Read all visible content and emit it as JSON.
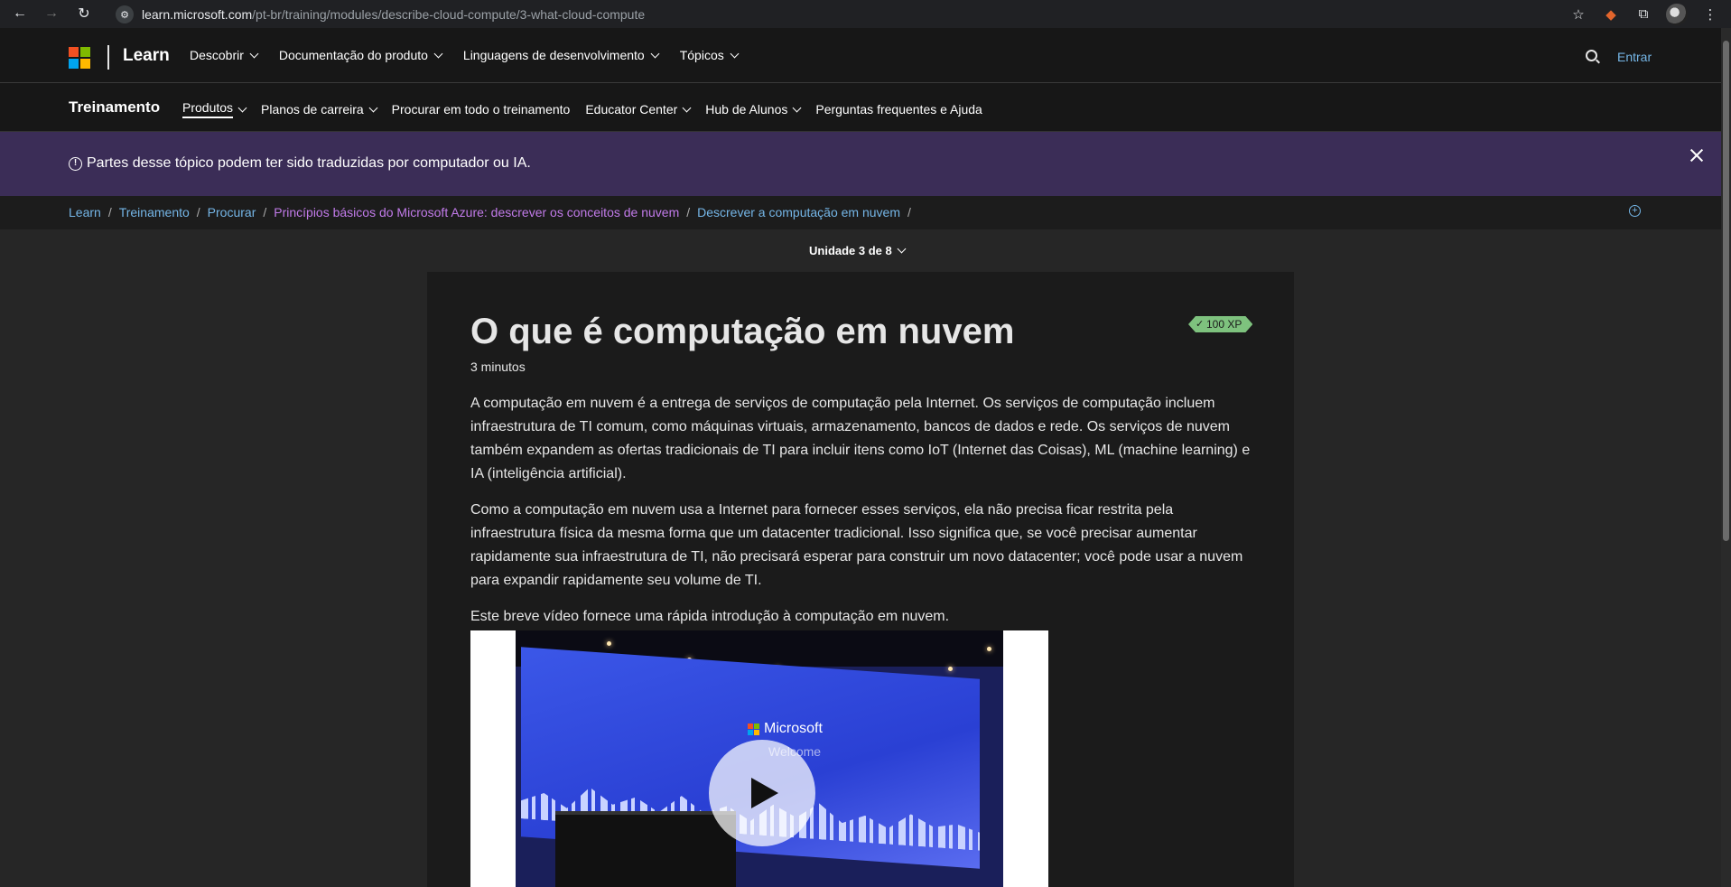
{
  "browser": {
    "url_host": "learn.microsoft.com",
    "url_path": "/pt-br/training/modules/describe-cloud-compute/3-what-cloud-compute"
  },
  "header": {
    "brand": "Learn",
    "nav": [
      "Descobrir",
      "Documentação do produto",
      "Linguagens de desenvolvimento",
      "Tópicos"
    ],
    "signin": "Entrar"
  },
  "subheader": {
    "brand": "Treinamento",
    "nav": [
      "Produtos",
      "Planos de carreira",
      "Procurar em todo o treinamento",
      "Educator Center",
      "Hub de Alunos",
      "Perguntas frequentes e Ajuda"
    ]
  },
  "banner": {
    "text": "Partes desse tópico podem ter sido traduzidas por computador ou IA."
  },
  "breadcrumb": [
    "Learn",
    "Treinamento",
    "Procurar",
    "Princípios básicos do Microsoft Azure: descrever os conceitos de nuvem",
    "Descrever a computação em nuvem"
  ],
  "unit_selector": "Unidade 3 de 8",
  "article": {
    "title": "O que é computação em nuvem",
    "duration": "3 minutos",
    "xp": "100 XP",
    "paragraphs": [
      "A computação em nuvem é a entrega de serviços de computação pela Internet. Os serviços de computação incluem infraestrutura de TI comum, como máquinas virtuais, armazenamento, bancos de dados e rede. Os serviços de nuvem também expandem as ofertas tradicionais de TI para incluir itens como IoT (Internet das Coisas), ML (machine learning) e IA (inteligência artificial).",
      "Como a computação em nuvem usa a Internet para fornecer esses serviços, ela não precisa ficar restrita pela infraestrutura física da mesma forma que um datacenter tradicional. Isso significa que, se você precisar aumentar rapidamente sua infraestrutura de TI, não precisará esperar para construir um novo datacenter; você pode usar a nuvem para expandir rapidamente seu volume de TI.",
      "Este breve vídeo fornece uma rápida introdução à computação em nuvem."
    ],
    "video": {
      "logo_text": "Microsoft",
      "welcome_text": "Welcome"
    }
  },
  "colors": {
    "banner_bg": "#3b2d57",
    "link": "#75b6e7",
    "visited_link": "#c27bea",
    "xp_badge": "#7ec27e"
  }
}
